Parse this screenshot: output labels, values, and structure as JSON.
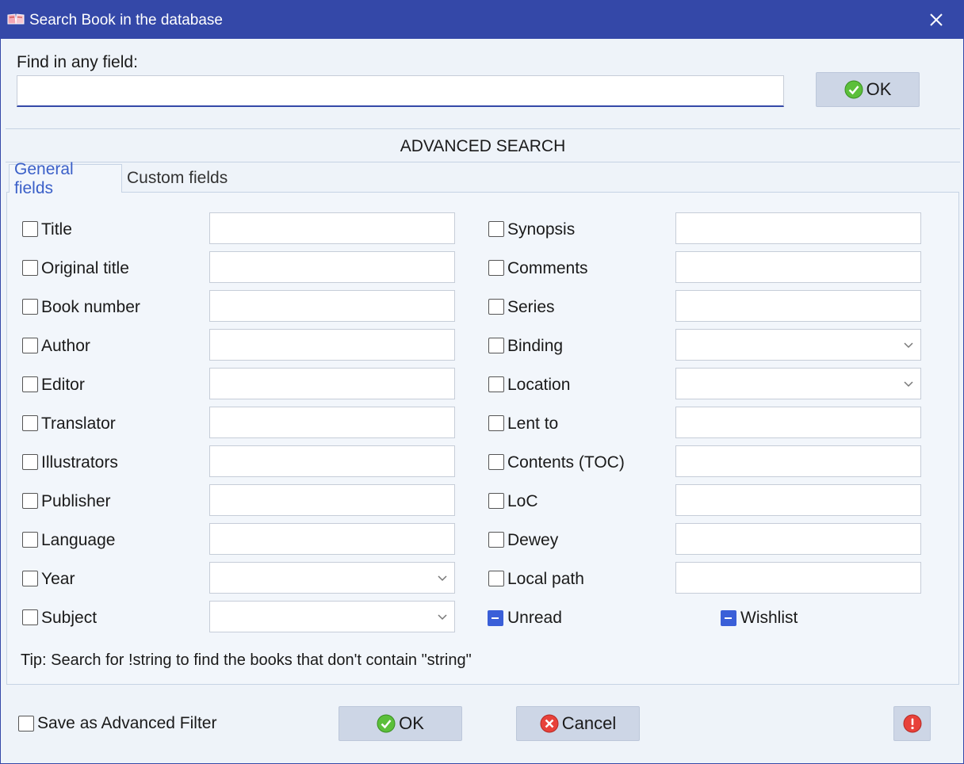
{
  "window": {
    "title": "Search Book in the database",
    "accent_color": "#3448a8",
    "close_icon": "close-icon"
  },
  "find": {
    "label": "Find in any field:",
    "value": "",
    "ok_label": "OK"
  },
  "advanced": {
    "title": "ADVANCED SEARCH",
    "tabs": [
      {
        "label": "General fields",
        "active": true
      },
      {
        "label": "Custom fields",
        "active": false
      }
    ]
  },
  "left_fields": [
    {
      "label": "Title",
      "type": "text",
      "checked": false
    },
    {
      "label": "Original title",
      "type": "text",
      "checked": false
    },
    {
      "label": "Book number",
      "type": "text",
      "checked": false
    },
    {
      "label": "Author",
      "type": "text",
      "checked": false
    },
    {
      "label": "Editor",
      "type": "text",
      "checked": false
    },
    {
      "label": "Translator",
      "type": "text",
      "checked": false
    },
    {
      "label": "Illustrators",
      "type": "text",
      "checked": false
    },
    {
      "label": "Publisher",
      "type": "text",
      "checked": false
    },
    {
      "label": "Language",
      "type": "text",
      "checked": false
    },
    {
      "label": "Year",
      "type": "combo",
      "checked": false
    },
    {
      "label": "Subject",
      "type": "combo",
      "checked": false
    }
  ],
  "right_fields": [
    {
      "label": "Synopsis",
      "type": "text",
      "checked": false
    },
    {
      "label": "Comments",
      "type": "text",
      "checked": false
    },
    {
      "label": "Series",
      "type": "text",
      "checked": false
    },
    {
      "label": "Binding",
      "type": "combo",
      "checked": false
    },
    {
      "label": "Location",
      "type": "combo",
      "checked": false
    },
    {
      "label": "Lent to",
      "type": "text",
      "checked": false
    },
    {
      "label": "Contents (TOC)",
      "type": "text",
      "checked": false
    },
    {
      "label": "LoC",
      "type": "text",
      "checked": false
    },
    {
      "label": "Dewey",
      "type": "text",
      "checked": false
    },
    {
      "label": "Local path",
      "type": "text",
      "checked": false
    }
  ],
  "flags": {
    "unread": {
      "label": "Unread",
      "state": "indeterminate"
    },
    "wishlist": {
      "label": "Wishlist",
      "state": "indeterminate"
    }
  },
  "tip": "Tip: Search for !string to find the books that don't contain \"string\"",
  "footer": {
    "save_filter_label": "Save as Advanced Filter",
    "ok_label": "OK",
    "cancel_label": "Cancel"
  }
}
